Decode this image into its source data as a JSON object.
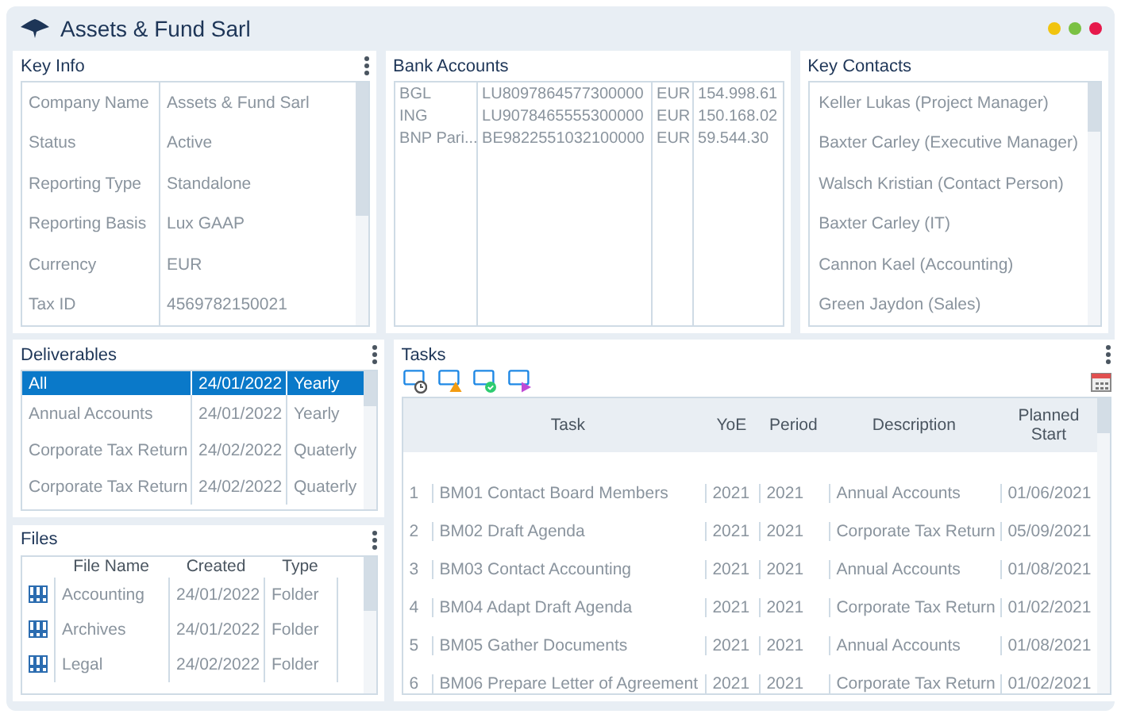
{
  "window": {
    "title": "Assets & Fund Sarl"
  },
  "key_info": {
    "title": "Key Info",
    "rows": [
      {
        "label": "Company Name",
        "value": "Assets & Fund Sarl"
      },
      {
        "label": "Status",
        "value": "Active"
      },
      {
        "label": "Reporting Type",
        "value": "Standalone"
      },
      {
        "label": "Reporting Basis",
        "value": "Lux GAAP"
      },
      {
        "label": "Currency",
        "value": "EUR"
      },
      {
        "label": "Tax ID",
        "value": "4569782150021"
      }
    ]
  },
  "bank_accounts": {
    "title": "Bank Accounts",
    "rows": [
      {
        "bank": "BGL",
        "iban": "LU8097864577300000",
        "currency": "EUR",
        "balance": "154.998.61"
      },
      {
        "bank": "ING",
        "iban": "LU9078465555300000",
        "currency": "EUR",
        "balance": "150.168.02"
      },
      {
        "bank": "BNP Pari...",
        "iban": "BE9822551032100000",
        "currency": "EUR",
        "balance": "59.544.30"
      }
    ]
  },
  "key_contacts": {
    "title": "Key Contacts",
    "items": [
      "Keller Lukas (Project Manager)",
      "Baxter Carley (Executive Manager)",
      "Walsch Kristian (Contact Person)",
      "Baxter Carley (IT)",
      "Cannon Kael  (Accounting)",
      "Green Jaydon (Sales)"
    ]
  },
  "deliverables": {
    "title": "Deliverables",
    "rows": [
      {
        "name": "All",
        "date": "24/01/2022",
        "frequency": "Yearly",
        "selected": true
      },
      {
        "name": "Annual Accounts",
        "date": "24/01/2022",
        "frequency": "Yearly",
        "selected": false
      },
      {
        "name": "Corporate Tax Return",
        "date": "24/02/2022",
        "frequency": "Quaterly",
        "selected": false
      },
      {
        "name": "Corporate Tax Return",
        "date": "24/02/2022",
        "frequency": "Quaterly",
        "selected": false
      }
    ]
  },
  "files": {
    "title": "Files",
    "columns": [
      "File Name",
      "Created",
      "Type"
    ],
    "rows": [
      {
        "name": "Accounting",
        "created": "24/01/2022",
        "type": "Folder"
      },
      {
        "name": "Archives",
        "created": "24/01/2022",
        "type": "Folder"
      },
      {
        "name": "Legal",
        "created": "24/02/2022",
        "type": "Folder"
      }
    ]
  },
  "tasks": {
    "title": "Tasks",
    "columns": [
      "Task",
      "YoE",
      "Period",
      "Description",
      "Planned Start"
    ],
    "rows": [
      {
        "number": "1",
        "task": "BM01 Contact Board Members",
        "yoe": "2021",
        "period": "2021",
        "description": "Annual Accounts",
        "planned_start": "01/06/2021"
      },
      {
        "number": "2",
        "task": "BM02 Draft Agenda",
        "yoe": "2021",
        "period": "2021",
        "description": "Corporate Tax Return",
        "planned_start": "05/09/2021"
      },
      {
        "number": "3",
        "task": "BM03 Contact Accounting",
        "yoe": "2021",
        "period": "2021",
        "description": "Annual Accounts",
        "planned_start": "01/08/2021"
      },
      {
        "number": "4",
        "task": "BM04 Adapt Draft Agenda",
        "yoe": "2021",
        "period": "2021",
        "description": "Corporate Tax Return",
        "planned_start": "01/02/2021"
      },
      {
        "number": "5",
        "task": "BM05 Gather Documents",
        "yoe": "2021",
        "period": "2021",
        "description": "Annual Accounts",
        "planned_start": "01/08/2021"
      },
      {
        "number": "6",
        "task": "BM06 Prepare Letter of Agreement",
        "yoe": "2021",
        "period": "2021",
        "description": "Corporate Tax Return",
        "planned_start": "01/02/2021"
      }
    ]
  }
}
